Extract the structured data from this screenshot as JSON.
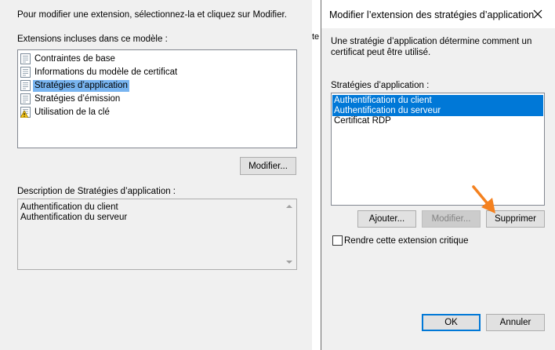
{
  "background_dialog": {
    "instruction": "Pour modifier une extension, sélectionnez-la et cliquez sur Modifier.",
    "extensions_label": "Extensions incluses dans ce modèle :",
    "extensions": [
      {
        "label": "Contraintes de base",
        "icon": "certificate-icon",
        "selected": false
      },
      {
        "label": "Informations du modèle de certificat",
        "icon": "certificate-icon",
        "selected": false
      },
      {
        "label": "Stratégies d’application",
        "icon": "certificate-icon",
        "selected": true
      },
      {
        "label": "Stratégies d’émission",
        "icon": "certificate-icon",
        "selected": false
      },
      {
        "label": "Utilisation de la clé",
        "icon": "certificate-warning-icon",
        "selected": false
      }
    ],
    "modify_button": "Modifier...",
    "description_label": "Description de Stratégies d’application :",
    "description_lines": [
      "Authentification du client",
      "Authentification du serveur"
    ],
    "partial_text": "te"
  },
  "dialog": {
    "title": "Modifier l’extension des stratégies d’application",
    "close_icon": "close-icon",
    "intro_line1": "Une stratégie d’application détermine comment un",
    "intro_line2": "certificat peut être utilisé.",
    "policies_label": "Stratégies d’application :",
    "policies": [
      {
        "label": "Authentification du client",
        "selected": true
      },
      {
        "label": "Authentification du serveur",
        "selected": true
      },
      {
        "label": "Certificat RDP",
        "selected": false
      }
    ],
    "add_button": "Ajouter...",
    "modify_button": "Modifier...",
    "remove_button": "Supprimer",
    "critical_checkbox_label": "Rendre cette extension critique",
    "critical_checked": false,
    "ok_button": "OK",
    "cancel_button": "Annuler"
  },
  "colors": {
    "selection": "#0078d7",
    "annotation_arrow": "#f4811f"
  }
}
